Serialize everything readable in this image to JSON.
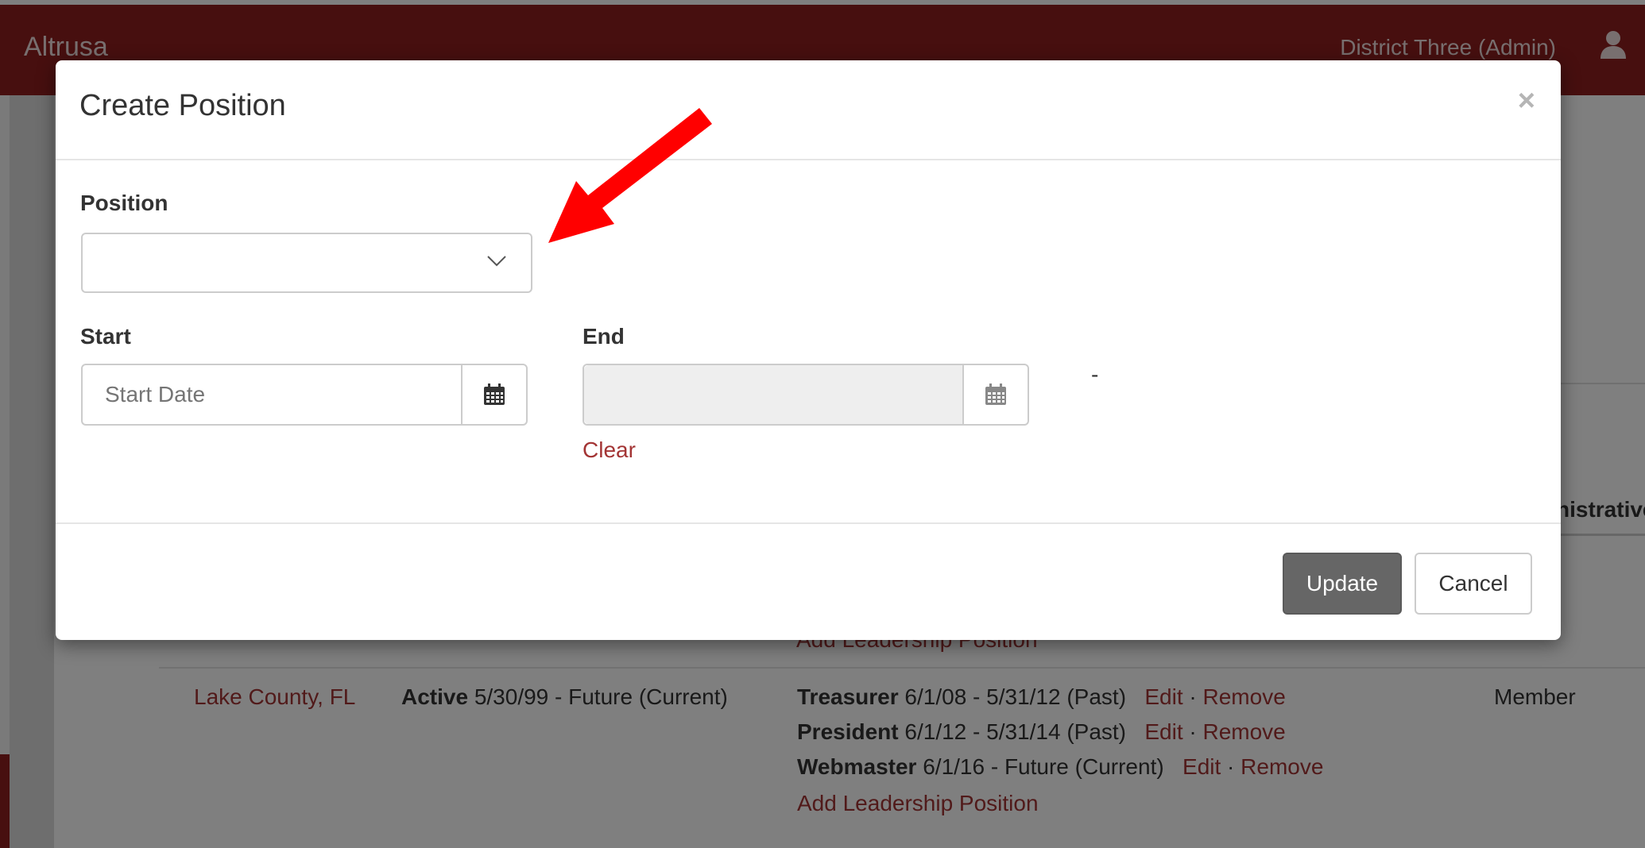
{
  "navbar": {
    "brand": "Altrusa",
    "user_label": "District Three (Admin)",
    "user_icon": "user-icon"
  },
  "table": {
    "column_header_fragment": "nistrative",
    "prev_row_add_leadership_fragment": "Add Leadership Position",
    "row": {
      "club": "Lake County, FL",
      "membership_status": "Active",
      "membership_dates": "5/30/99 - Future (Current)",
      "positions": [
        {
          "title": "Treasurer",
          "dates": "6/1/08 - 5/31/12 (Past)",
          "edit": "Edit",
          "sep": "·",
          "remove": "Remove"
        },
        {
          "title": "President",
          "dates": "6/1/12 - 5/31/14 (Past)",
          "edit": "Edit",
          "sep": "·",
          "remove": "Remove"
        },
        {
          "title": "Webmaster",
          "dates": "6/1/16 - Future (Current)",
          "edit": "Edit",
          "sep": "·",
          "remove": "Remove"
        }
      ],
      "add_leadership": "Add Leadership Position",
      "role": "Member"
    }
  },
  "modal": {
    "title": "Create Position",
    "close_symbol": "×",
    "position_label": "Position",
    "position_value": "",
    "start_label": "Start",
    "start_placeholder": "Start Date",
    "end_label": "End",
    "end_value": "",
    "clear_label": "Clear",
    "dash": "-",
    "update_label": "Update",
    "cancel_label": "Cancel"
  },
  "colors": {
    "brand_red": "#8e1e1e",
    "link_red": "#a33434",
    "annotation_arrow": "#ff0000",
    "button_gray": "#666666"
  }
}
